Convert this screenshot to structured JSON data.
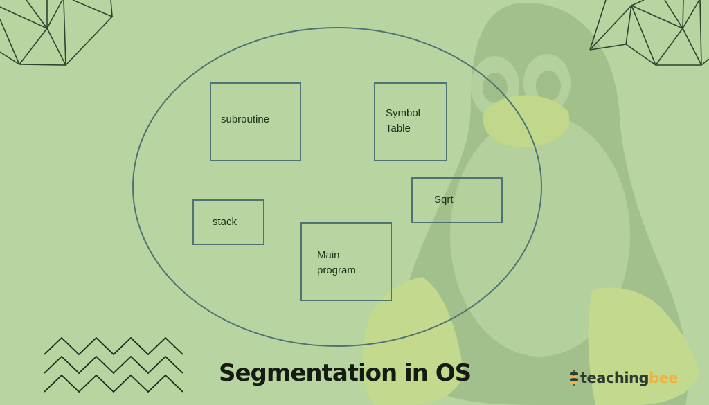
{
  "diagram": {
    "title": "Segmentation in OS",
    "container_shape": "ellipse",
    "segments": [
      {
        "id": "subroutine",
        "label": "subroutine"
      },
      {
        "id": "symbol-table",
        "label": "Symbol\nTable"
      },
      {
        "id": "stack",
        "label": "stack"
      },
      {
        "id": "sqrt",
        "label": "Sqrt"
      },
      {
        "id": "main-program",
        "label": "Main\nprogram"
      }
    ]
  },
  "branding": {
    "logo_part1": "teaching",
    "logo_part2": "bee",
    "logo_icon": "bee-stack-icon"
  },
  "decorations": {
    "background_mascot": "penguin-silhouette",
    "top_left": "triangle-mesh",
    "top_right": "triangle-mesh",
    "bottom_left": "zigzag-lines"
  },
  "colors": {
    "background": "#b8d4a0",
    "outline": "#4f7375",
    "text": "#1f2d1a",
    "logo_dark": "#2e3a33",
    "logo_accent": "#f0b340"
  }
}
